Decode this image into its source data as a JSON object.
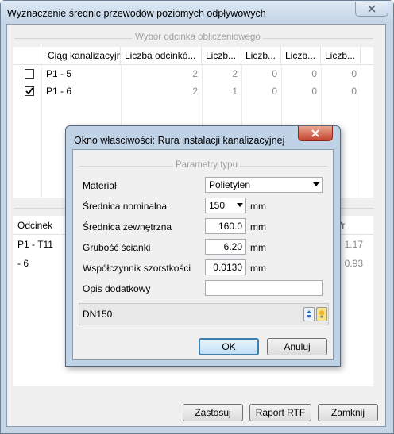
{
  "main": {
    "title": "Wyznaczenie średnic przewodów poziomych odpływowych",
    "close_label": "X",
    "group_label": "Wybór odcinka obliczeniowego",
    "columns": [
      "Ciąg kanalizacyjny",
      "Liczba odcinkó...",
      "Liczb...",
      "Liczb...",
      "Liczb...",
      "Liczb..."
    ],
    "rows": [
      {
        "checked": false,
        "name": "P1 - 5",
        "values": [
          "2",
          "2",
          "0",
          "0",
          "0"
        ]
      },
      {
        "checked": true,
        "name": "P1 - 6",
        "values": [
          "2",
          "1",
          "0",
          "0",
          "0"
        ]
      }
    ],
    "lower_grid": {
      "col_first": "Odcinek",
      "col_last": "/r",
      "rows": [
        {
          "name": "P1  - T11",
          "value": "1.17"
        },
        {
          "name": "- 6",
          "value": "0.93"
        }
      ]
    },
    "buttons": {
      "apply": "Zastosuj",
      "report": "Raport RTF",
      "close": "Zamknij"
    }
  },
  "dialog": {
    "title": "Okno właściwości: Rura instalacji kanalizacyjnej",
    "close_label": "X",
    "group_label": "Parametry typu",
    "fields": {
      "material_label": "Materiał",
      "material_value": "Polietylen",
      "dn_label": "Średnica nominalna",
      "dn_value": "150",
      "dn_unit": "mm",
      "od_label": "Średnica zewnętrzna",
      "od_value": "160.0",
      "od_unit": "mm",
      "wall_label": "Grubość ścianki",
      "wall_value": "6.20",
      "wall_unit": "mm",
      "rough_label": "Współczynnik szorstkości",
      "rough_value": "0.0130",
      "rough_unit": "mm",
      "desc_label": "Opis dodatkowy",
      "desc_value": ""
    },
    "info_text": "DN150",
    "ok_label": "OK",
    "cancel_label": "Anuluj"
  }
}
